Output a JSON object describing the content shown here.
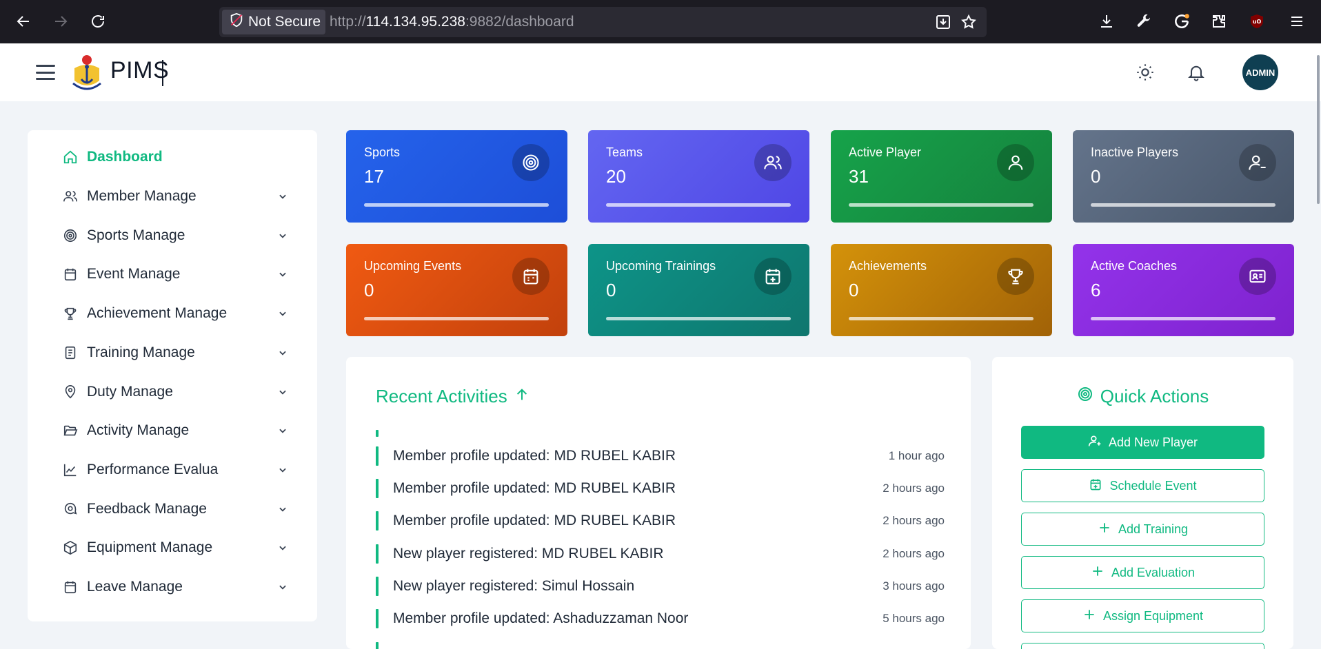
{
  "browser": {
    "security_label": "Not Secure",
    "url_prefix": "http://",
    "url_host": "114.134.95.238",
    "url_rest": ":9882/dashboard"
  },
  "app": {
    "brand": "PIMS",
    "avatar_label": "ADMIN"
  },
  "sidebar": {
    "items": [
      {
        "label": "Dashboard",
        "icon": "home-icon"
      },
      {
        "label": "Member Manage",
        "icon": "users-icon"
      },
      {
        "label": "Sports Manage",
        "icon": "target-icon"
      },
      {
        "label": "Event Manage",
        "icon": "calendar-icon"
      },
      {
        "label": "Achievement Manage",
        "icon": "trophy-icon"
      },
      {
        "label": "Training Manage",
        "icon": "book-icon"
      },
      {
        "label": "Duty Manage",
        "icon": "map-pin-icon"
      },
      {
        "label": "Activity Manage",
        "icon": "folder-open-icon"
      },
      {
        "label": "Performance Evalua",
        "icon": "chart-line-icon"
      },
      {
        "label": "Feedback Manage",
        "icon": "message-search-icon"
      },
      {
        "label": "Equipment Manage",
        "icon": "box-icon"
      },
      {
        "label": "Leave Manage",
        "icon": "calendar-icon"
      }
    ]
  },
  "stats": [
    {
      "label": "Sports",
      "value": "17",
      "color": "#2563eb",
      "icon": "target-icon"
    },
    {
      "label": "Teams",
      "value": "20",
      "color": "#5b55e8",
      "icon": "users-icon"
    },
    {
      "label": "Active Player",
      "value": "31",
      "color": "#16a34a",
      "icon": "user-icon"
    },
    {
      "label": "Inactive Players",
      "value": "0",
      "color": "#5f6b7d",
      "icon": "user-minus-icon"
    },
    {
      "label": "Upcoming Events",
      "value": "0",
      "color": "#ea580c",
      "icon": "calendar-icon"
    },
    {
      "label": "Upcoming Trainings",
      "value": "0",
      "color": "#0f9488",
      "icon": "calendar-plus-icon"
    },
    {
      "label": "Achievements",
      "value": "0",
      "color": "#ca8a04",
      "icon": "trophy-icon"
    },
    {
      "label": "Active Coaches",
      "value": "6",
      "color": "#9333ea",
      "icon": "id-card-icon"
    }
  ],
  "recent": {
    "title": "Recent Activities",
    "items": [
      {
        "text": "Member profile updated: MD RUBEL KABIR",
        "time": "1 hour ago"
      },
      {
        "text": "Member profile updated: MD RUBEL KABIR",
        "time": "2 hours ago"
      },
      {
        "text": "Member profile updated: MD RUBEL KABIR",
        "time": "2 hours ago"
      },
      {
        "text": "New player registered: MD RUBEL KABIR",
        "time": "2 hours ago"
      },
      {
        "text": "New player registered: Simul Hossain",
        "time": "3 hours ago"
      },
      {
        "text": "Member profile updated: Ashaduzzaman Noor",
        "time": "5 hours ago"
      }
    ]
  },
  "quick_actions": {
    "title": "Quick Actions",
    "buttons": [
      {
        "label": "Add New Player",
        "icon": "user-plus-icon"
      },
      {
        "label": "Schedule Event",
        "icon": "calendar-plus-icon"
      },
      {
        "label": "Add Training",
        "icon": "plus-icon"
      },
      {
        "label": "Add Evaluation",
        "icon": "plus-icon"
      },
      {
        "label": "Assign Equipment",
        "icon": "plus-icon"
      }
    ]
  },
  "colors": {
    "accent": "#10b981"
  }
}
